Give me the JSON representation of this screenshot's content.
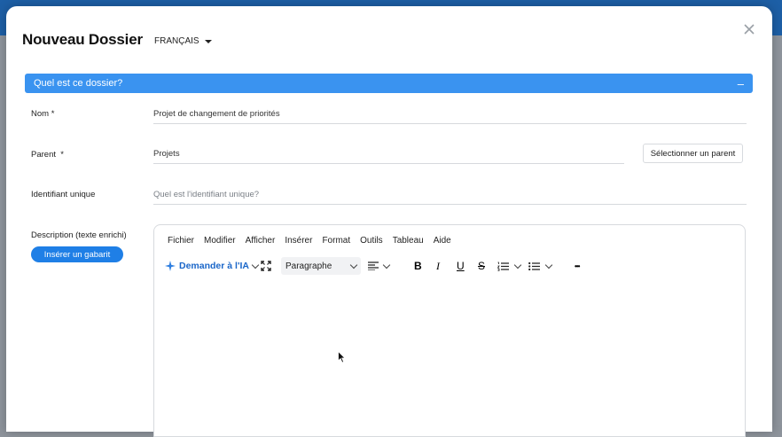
{
  "dialog": {
    "title": "Nouveau Dossier",
    "language": "FRANÇAIS",
    "close_glyph": "×"
  },
  "section": {
    "title": "Quel est ce dossier?",
    "toggle": "–"
  },
  "form": {
    "name": {
      "label": "Nom *",
      "value": "Projet de changement de priorités"
    },
    "parent": {
      "label": "Parent  *",
      "value": "Projets",
      "button": "Sélectionner un parent"
    },
    "identifier": {
      "label": "Identifiant unique",
      "placeholder": "Quel est l'identifiant unique?"
    },
    "description": {
      "label": "Description (texte enrichi)",
      "template_button": "Insérer un gabarit"
    }
  },
  "editor": {
    "menu": [
      "Fichier",
      "Modifier",
      "Afficher",
      "Insérer",
      "Format",
      "Outils",
      "Tableau",
      "Aide"
    ],
    "ai_label": "Demander à l'IA",
    "block_format": "Paragraphe",
    "bold": "B",
    "italic": "I",
    "underline": "U",
    "strike": "S",
    "more": "•••"
  },
  "colors": {
    "accent": "#3a93f0",
    "button_primary": "#1f7fe6",
    "ai_link": "#1a66c9"
  }
}
